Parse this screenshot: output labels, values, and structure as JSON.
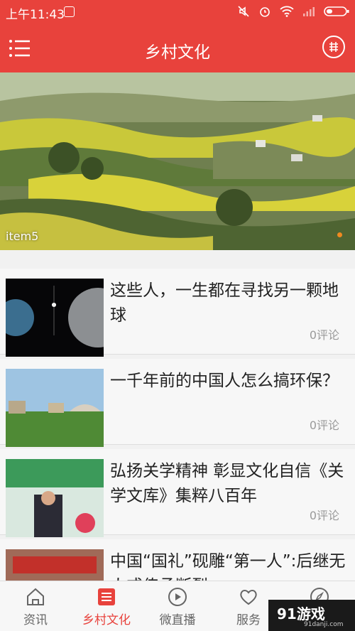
{
  "status_bar": {
    "time": "上午11:43"
  },
  "app_bar": {
    "title": "乡村文化"
  },
  "banner": {
    "caption": "item5"
  },
  "articles": [
    {
      "title": "这些人，一生都在寻找另一颗地球",
      "comments": "0评论"
    },
    {
      "title": "一千年前的中国人怎么搞环保？",
      "comments": "0评论"
    },
    {
      "title": "弘扬关学精神 彰显文化自信《关学文库》集粹八百年",
      "comments": "0评论"
    },
    {
      "title": "中国“国礼”砚雕“第一人”:后继无人或传承断裂",
      "comments": ""
    }
  ],
  "tabs": [
    {
      "label": "资讯",
      "icon": "home-icon"
    },
    {
      "label": "乡村文化",
      "icon": "document-icon",
      "active": true
    },
    {
      "label": "微直播",
      "icon": "play-icon"
    },
    {
      "label": "服务",
      "icon": "heart-icon"
    },
    {
      "label": "",
      "icon": "compass-icon"
    }
  ],
  "watermark": {
    "brand": "91游戏",
    "url": "91danji.com"
  },
  "colors": {
    "accent": "#e8423c",
    "inactive": "#666666"
  }
}
